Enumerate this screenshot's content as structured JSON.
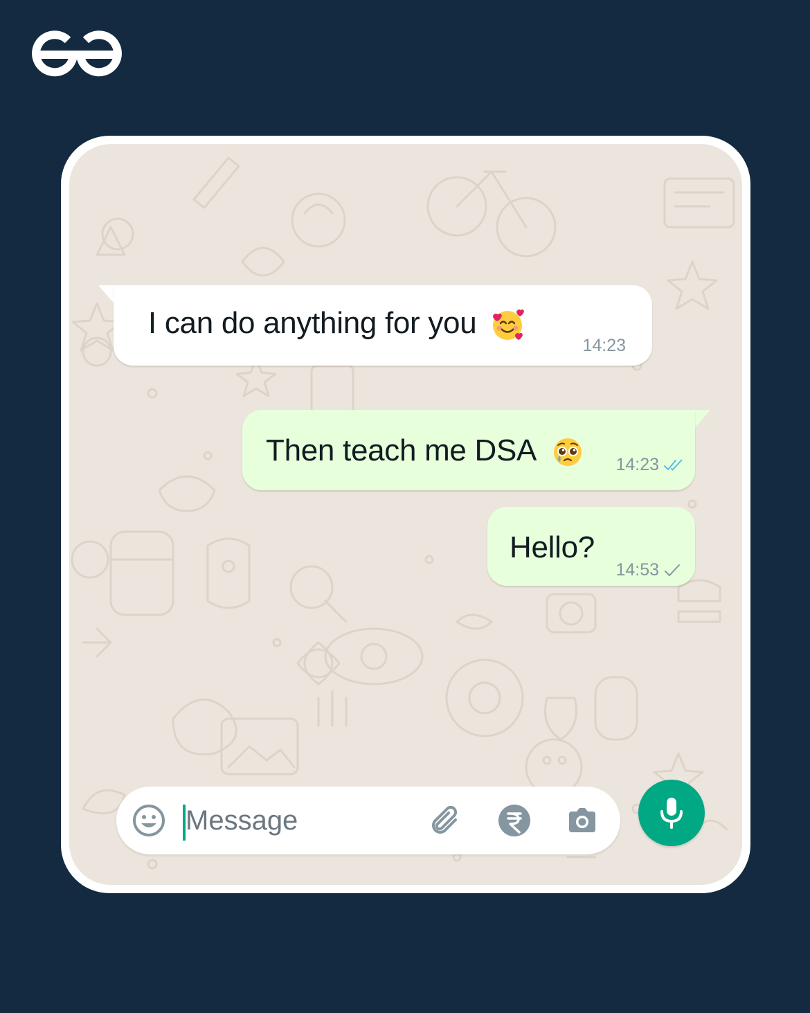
{
  "brand": {
    "logo_icon": "geeksforgeeks-logo-icon"
  },
  "colors": {
    "page_background": "#132a40",
    "chat_wallpaper": "#ece5dd",
    "incoming_bubble": "#ffffff",
    "outgoing_bubble": "#e7ffdb",
    "accent": "#00a884",
    "read_ticks": "#53bdeb",
    "timestamp": "#8696a0"
  },
  "chat": {
    "messages": [
      {
        "direction": "incoming",
        "text": "I can do anything for you",
        "emoji": "smiling-face-with-hearts",
        "time": "14:23"
      },
      {
        "direction": "outgoing",
        "text": "Then teach me DSA",
        "emoji": "pleading-face",
        "time": "14:23",
        "status": "read",
        "status_icon": "double-check-icon"
      },
      {
        "direction": "outgoing",
        "text": "Hello?",
        "time": "14:53",
        "status": "sent",
        "status_icon": "single-check-icon"
      }
    ]
  },
  "composer": {
    "placeholder": "Message",
    "icons": [
      "emoji-icon",
      "attach-icon",
      "rupee-payment-icon",
      "camera-icon"
    ],
    "send_icon": "microphone-icon"
  }
}
